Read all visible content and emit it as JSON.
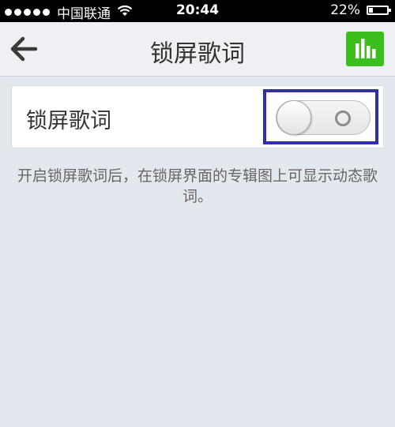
{
  "status_bar": {
    "carrier": "中国联通",
    "time": "20:44",
    "battery": "22%",
    "battery_level": 0.22
  },
  "navbar": {
    "title": "锁屏歌词"
  },
  "setting": {
    "label": "锁屏歌词",
    "enabled": false
  },
  "description": "开启锁屏歌词后，在锁屏界面的专辑图上可显示动态歌词。",
  "colors": {
    "accent_green": "#3cbf1c",
    "highlight_box": "#2e2fa9"
  }
}
